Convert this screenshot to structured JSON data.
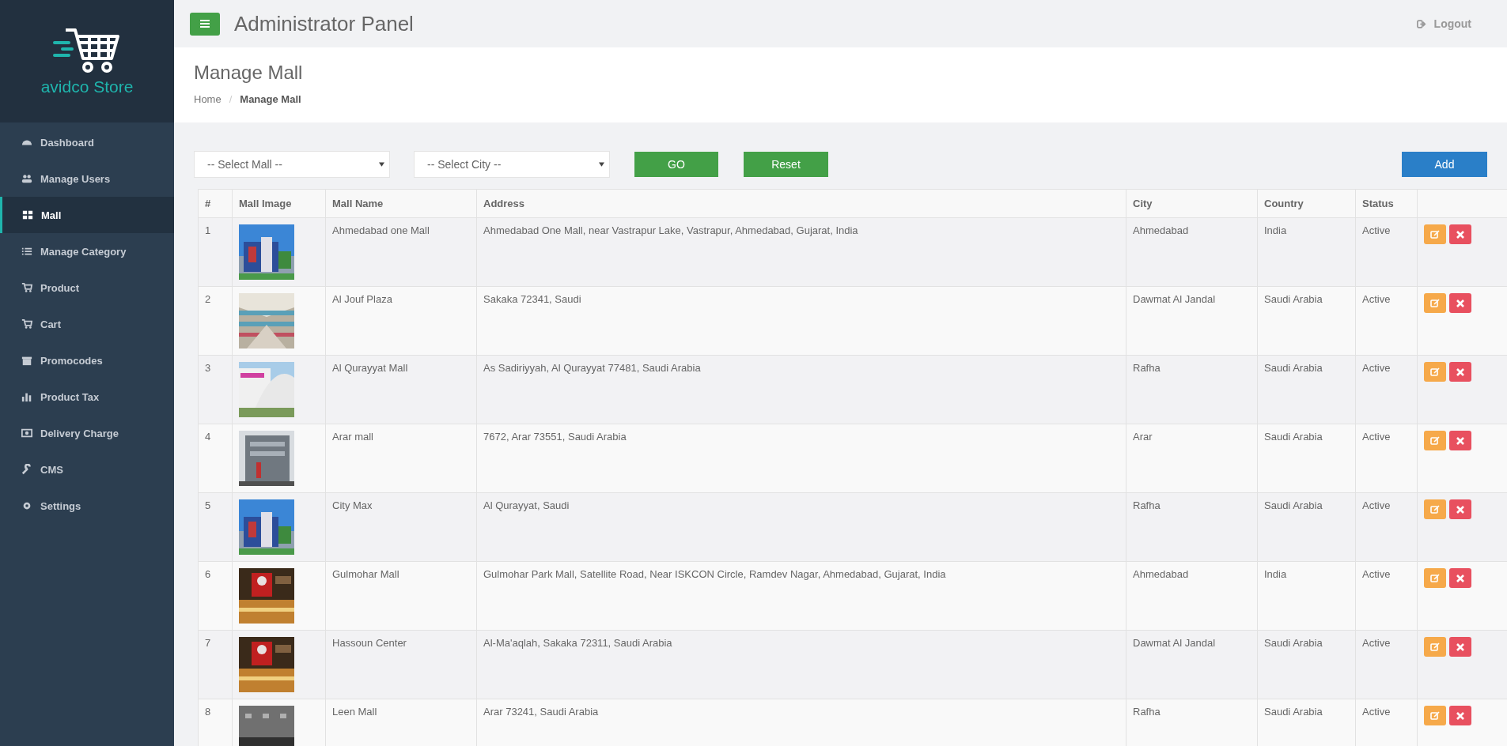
{
  "brand": {
    "name": "avidco Store"
  },
  "sidebar": {
    "items": [
      {
        "label": "Dashboard",
        "selected": false
      },
      {
        "label": "Manage Users",
        "selected": false
      },
      {
        "label": "Mall",
        "selected": true
      },
      {
        "label": "Manage Category",
        "selected": false
      },
      {
        "label": "Product",
        "selected": false
      },
      {
        "label": "Cart",
        "selected": false
      },
      {
        "label": "Promocodes",
        "selected": false
      },
      {
        "label": "Product Tax",
        "selected": false
      },
      {
        "label": "Delivery Charge",
        "selected": false
      },
      {
        "label": "CMS",
        "selected": false
      },
      {
        "label": "Settings",
        "selected": false
      }
    ]
  },
  "topbar": {
    "title": "Administrator Panel",
    "logout": "Logout"
  },
  "page": {
    "title": "Manage Mall",
    "breadcrumb": [
      "Home",
      "Manage Mall"
    ],
    "breadcrumb_separator": "/"
  },
  "filters": {
    "mall_select": "-- Select Mall --",
    "city_select": "-- Select City --",
    "go": "GO",
    "reset": "Reset",
    "add": "Add"
  },
  "table": {
    "columns": [
      "#",
      "Mall Image",
      "Mall Name",
      "Address",
      "City",
      "Country",
      "Status"
    ],
    "rows": [
      {
        "number": "1",
        "name": "Ahmedabad one Mall",
        "address": "Ahmedabad One Mall, near Vastrapur Lake, Vastrapur, Ahmedabad, Gujarat, India",
        "city": "Ahmedabad",
        "country": "India",
        "status": "Active"
      },
      {
        "number": "2",
        "name": "Al Jouf Plaza",
        "address": "Sakaka 72341, Saudi",
        "city": "Dawmat Al Jandal",
        "country": "Saudi Arabia",
        "status": "Active"
      },
      {
        "number": "3",
        "name": "Al Qurayyat Mall",
        "address": "As Sadiriyyah, Al Qurayyat 77481, Saudi Arabia",
        "city": "Rafha",
        "country": "Saudi Arabia",
        "status": "Active"
      },
      {
        "number": "4",
        "name": "Arar mall",
        "address": "7672, Arar 73551, Saudi Arabia",
        "city": "Arar",
        "country": "Saudi Arabia",
        "status": "Active"
      },
      {
        "number": "5",
        "name": "City Max",
        "address": "Al Qurayyat, Saudi",
        "city": "Rafha",
        "country": "Saudi Arabia",
        "status": "Active"
      },
      {
        "number": "6",
        "name": "Gulmohar Mall",
        "address": "Gulmohar Park Mall, Satellite Road, Near ISKCON Circle, Ramdev Nagar, Ahmedabad, Gujarat, India",
        "city": "Ahmedabad",
        "country": "India",
        "status": "Active"
      },
      {
        "number": "7",
        "name": "Hassoun Center",
        "address": "Al-Ma'aqlah, Sakaka 72311, Saudi Arabia",
        "city": "Dawmat Al Jandal",
        "country": "Saudi Arabia",
        "status": "Active"
      },
      {
        "number": "8",
        "name": "Leen Mall",
        "address": "Arar 73241, Saudi Arabia",
        "city": "Rafha",
        "country": "Saudi Arabia",
        "status": "Active"
      }
    ]
  }
}
